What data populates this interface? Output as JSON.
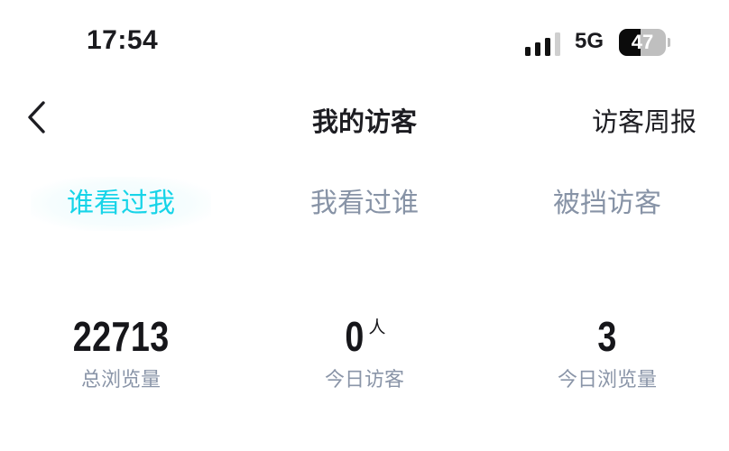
{
  "status_bar": {
    "time": "17:54",
    "network": "5G",
    "battery_level": "47",
    "battery_fraction": 0.47,
    "signal_bars": 4,
    "signal_active": 3
  },
  "header": {
    "back_icon": "chevron-left-icon",
    "title": "我的访客",
    "weekly_report": "访客周报"
  },
  "tabs": [
    {
      "label": "谁看过我",
      "active": true
    },
    {
      "label": "我看过谁",
      "active": false
    },
    {
      "label": "被挡访客",
      "active": false
    }
  ],
  "stats": [
    {
      "value": "22713",
      "unit": "",
      "label": "总浏览量"
    },
    {
      "value": "0",
      "unit": "人",
      "label": "今日访客"
    },
    {
      "value": "3",
      "unit": "",
      "label": "今日浏览量"
    }
  ],
  "colors": {
    "accent": "#17d4e8",
    "inactive_tab": "#8793a6",
    "muted_label": "#8a95a8",
    "text": "#1d1d22"
  }
}
